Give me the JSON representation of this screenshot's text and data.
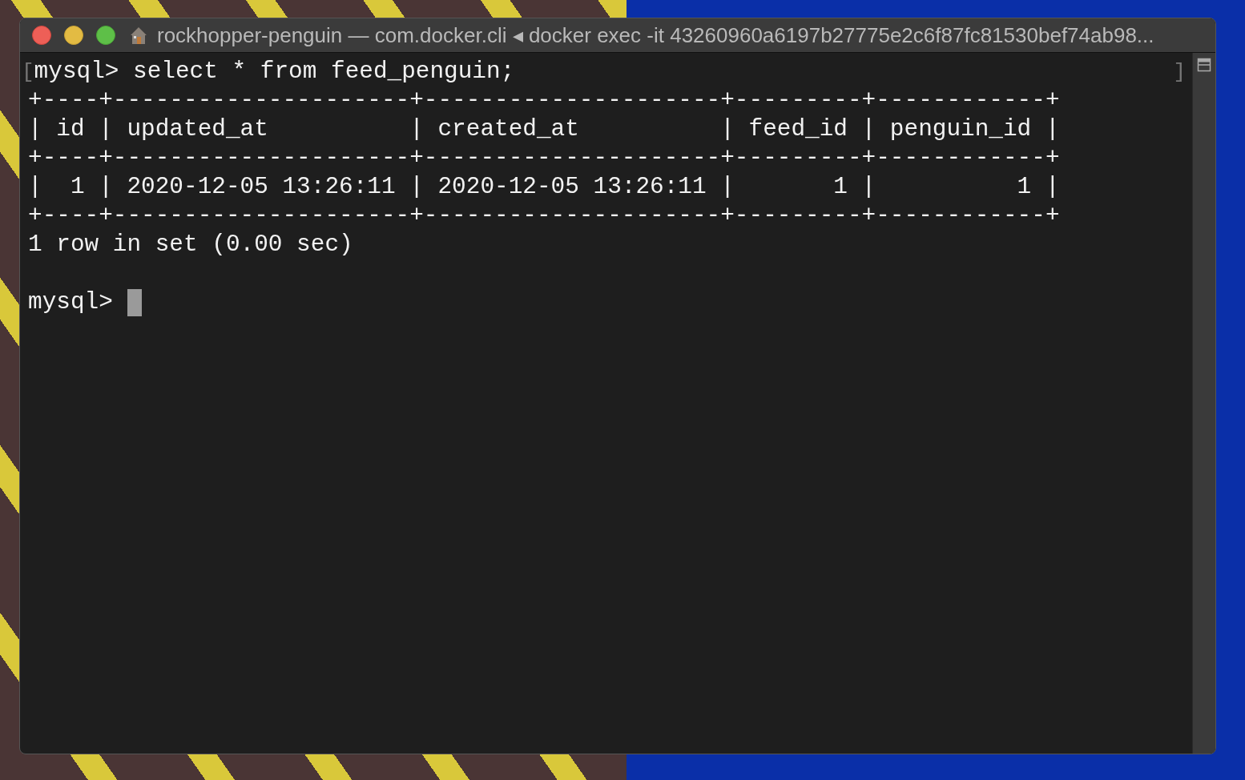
{
  "window": {
    "title": "rockhopper-penguin — com.docker.cli ◂ docker exec -it 43260960a6197b27775e2c6f87fc81530bef74ab98..."
  },
  "terminal": {
    "bracket_open": "[",
    "bracket_close": "]",
    "lines": [
      "mysql> select * from feed_penguin;",
      "+----+---------------------+---------------------+---------+------------+",
      "| id | updated_at          | created_at          | feed_id | penguin_id |",
      "+----+---------------------+---------------------+---------+------------+",
      "|  1 | 2020-12-05 13:26:11 | 2020-12-05 13:26:11 |       1 |          1 |",
      "+----+---------------------+---------------------+---------+------------+",
      "1 row in set (0.00 sec)"
    ],
    "prompt": {
      "text": "mysql>",
      "cursor": true
    }
  }
}
